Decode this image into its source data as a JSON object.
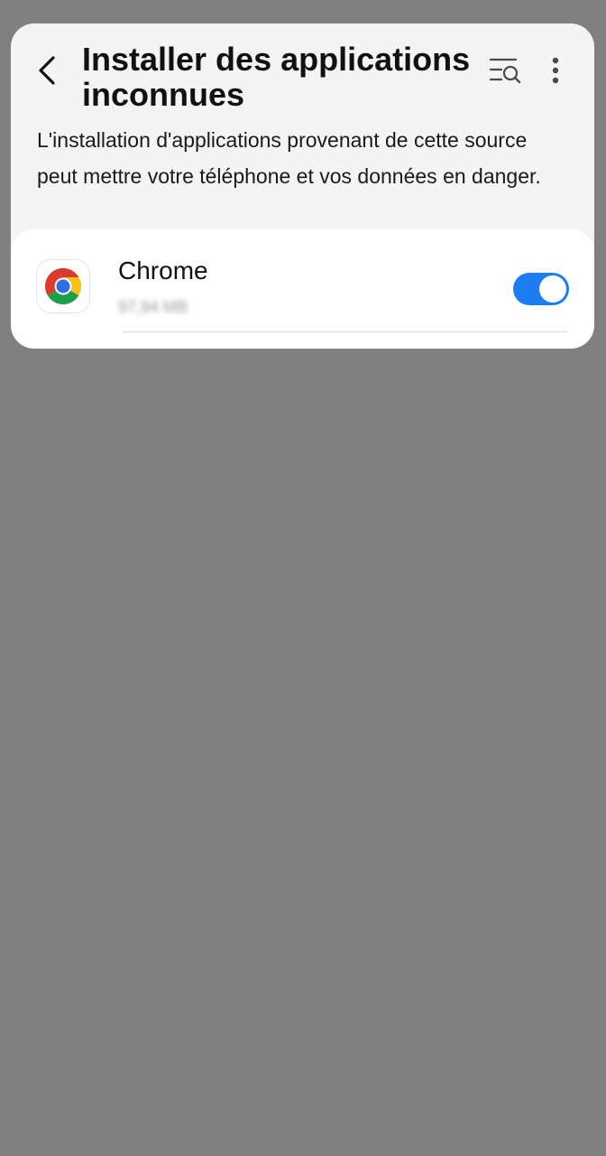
{
  "header": {
    "title": "Installer des applications inconnues",
    "back_icon": "back-arrow-icon",
    "search_icon": "search-list-icon",
    "more_icon": "more-vertical-icon"
  },
  "description": "L'installation d'applications provenant de cette source peut mettre votre téléphone et vos données en danger.",
  "apps": [
    {
      "name": "Chrome",
      "size": "97,94 MB",
      "icon": "chrome-icon",
      "allowed": true
    }
  ],
  "colors": {
    "toggle_on": "#1e7cf2",
    "card_background": "#f4f4f4",
    "page_background": "#808080"
  }
}
